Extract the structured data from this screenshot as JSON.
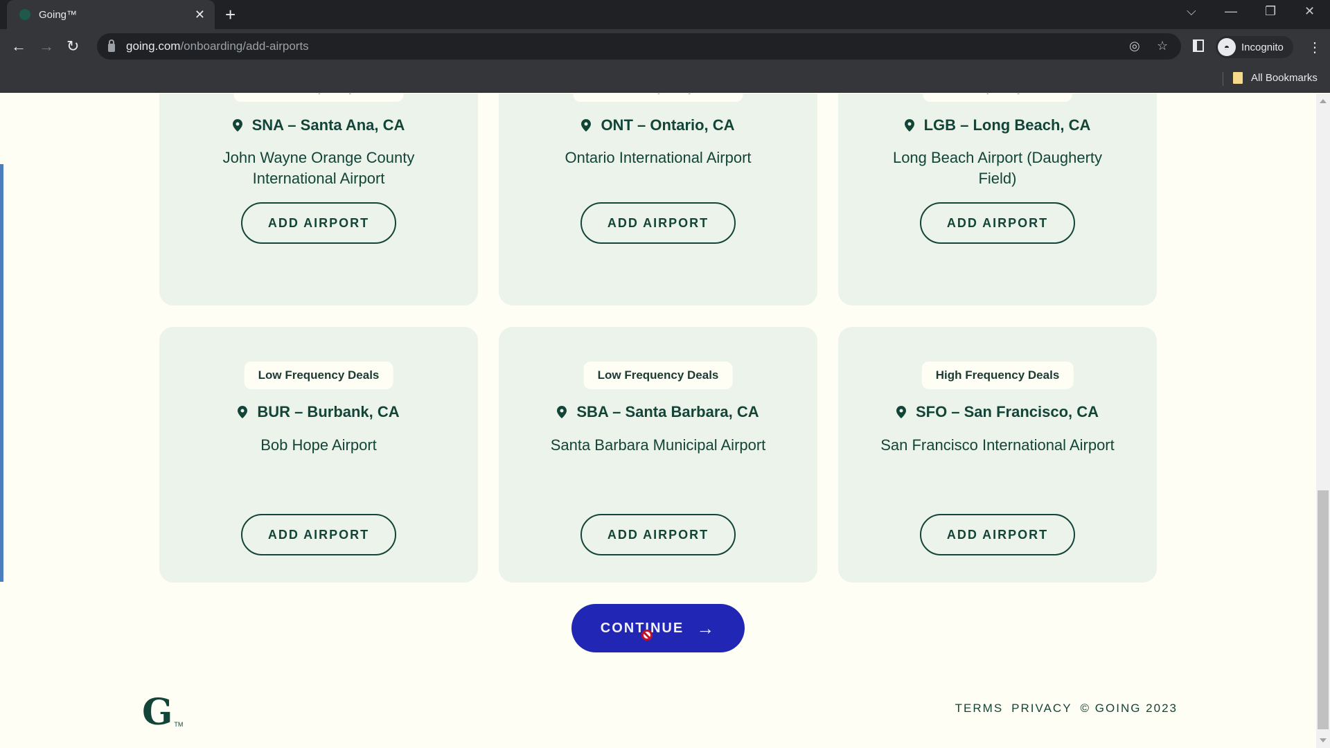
{
  "browser": {
    "tab_title": "Going™",
    "url_host": "going.com",
    "url_path": "/onboarding/add-airports",
    "profile_label": "Incognito",
    "bookmarks_label": "All Bookmarks"
  },
  "cards": [
    {
      "badge": "Medium Frequency Deals",
      "city": "SNA – Santa Ana, CA",
      "airport": "John Wayne Orange County International Airport",
      "button": "ADD AIRPORT"
    },
    {
      "badge": "Medium Frequency Deals",
      "city": "ONT – Ontario, CA",
      "airport": "Ontario International Airport",
      "button": "ADD AIRPORT"
    },
    {
      "badge": "Low Frequency Deals",
      "city": "LGB – Long Beach, CA",
      "airport": "Long Beach Airport (Daugherty Field)",
      "button": "ADD AIRPORT"
    },
    {
      "badge": "Low Frequency Deals",
      "city": "BUR – Burbank, CA",
      "airport": "Bob Hope Airport",
      "button": "ADD AIRPORT"
    },
    {
      "badge": "Low Frequency Deals",
      "city": "SBA – Santa Barbara, CA",
      "airport": "Santa Barbara Municipal Airport",
      "button": "ADD AIRPORT"
    },
    {
      "badge": "High Frequency Deals",
      "city": "SFO – San Francisco, CA",
      "airport": "San Francisco International Airport",
      "button": "ADD AIRPORT"
    }
  ],
  "continue_label": "CONTINUE",
  "footer": {
    "logo_tm": "TM",
    "terms": "TERMS",
    "privacy": "PRIVACY",
    "copyright": "© GOING 2023"
  },
  "colors": {
    "brand_green": "#134438",
    "card_bg": "#ecf3ea",
    "continue_blue": "#2226b4",
    "page_bg": "#fefef5"
  }
}
